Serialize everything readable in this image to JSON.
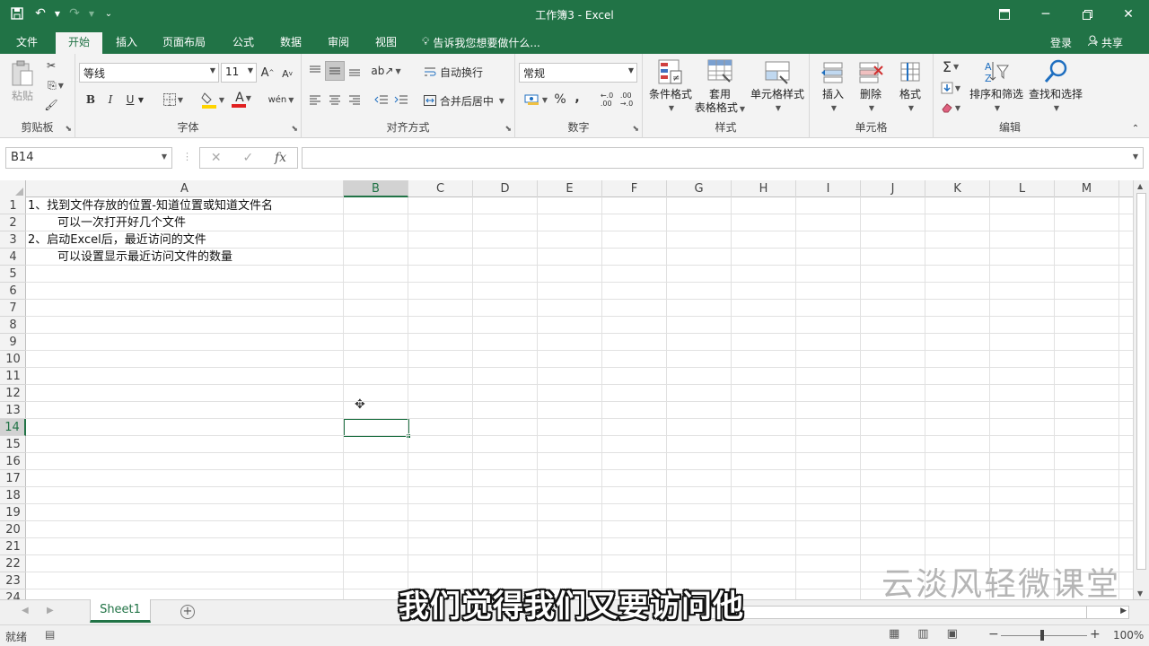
{
  "window": {
    "title": "工作簿3 - Excel",
    "qat": [
      {
        "name": "save-icon",
        "glyph": "🖫"
      },
      {
        "name": "undo-icon",
        "glyph": "↶"
      },
      {
        "name": "redo-icon",
        "glyph": "↷"
      },
      {
        "name": "customize-icon",
        "glyph": "⌄"
      }
    ],
    "window_buttons": [
      {
        "name": "ribbon-display-options-icon",
        "glyph": "⧉"
      },
      {
        "name": "minimize-icon",
        "glyph": "─"
      },
      {
        "name": "restore-icon",
        "glyph": "❐"
      },
      {
        "name": "close-icon",
        "glyph": "✕"
      }
    ]
  },
  "tabs": [
    {
      "label": "文件",
      "active": false
    },
    {
      "label": "开始",
      "active": true
    },
    {
      "label": "插入",
      "active": false
    },
    {
      "label": "页面布局",
      "active": false
    },
    {
      "label": "公式",
      "active": false
    },
    {
      "label": "数据",
      "active": false
    },
    {
      "label": "审阅",
      "active": false
    },
    {
      "label": "视图",
      "active": false
    }
  ],
  "tell_me": "告诉我您想要做什么...",
  "login": "登录",
  "share": "共享",
  "ribbon": {
    "clipboard": {
      "label": "剪贴板",
      "paste": "粘贴"
    },
    "font": {
      "label": "字体",
      "font_name": "等线",
      "font_size": "11",
      "bold": "B",
      "italic": "I",
      "underline": "U",
      "increase": "A",
      "decrease": "A",
      "font_color_letter": "A",
      "phonetic": "wén"
    },
    "alignment": {
      "label": "对齐方式",
      "wrap": "自动换行",
      "merge": "合并后居中"
    },
    "number": {
      "label": "数字",
      "format": "常规",
      "percent": "%",
      "comma": ","
    },
    "styles": {
      "label": "样式",
      "conditional": "条件格式",
      "table_line1": "套用",
      "table_line2": "表格格式",
      "cell_styles": "单元格样式"
    },
    "cells": {
      "label": "单元格",
      "insert": "插入",
      "delete": "删除",
      "format": "格式"
    },
    "editing": {
      "label": "编辑",
      "sort_filter": "排序和筛选",
      "find_select": "查找和选择"
    }
  },
  "formula_bar": {
    "name_box": "B14",
    "formula": ""
  },
  "columns": [
    "A",
    "B",
    "C",
    "D",
    "E",
    "F",
    "G",
    "H",
    "I",
    "J",
    "K",
    "L",
    "M"
  ],
  "selected_column": "B",
  "rows": [
    "1",
    "2",
    "3",
    "4",
    "5",
    "6",
    "7",
    "8",
    "9",
    "10",
    "11",
    "12",
    "13",
    "14",
    "15",
    "16",
    "17",
    "18",
    "19",
    "20",
    "21",
    "22",
    "23",
    "24"
  ],
  "selected_row": "14",
  "cells": {
    "A1": "1、找到文件存放的位置-知道位置或知道文件名",
    "A2": "可以一次打开好几个文件",
    "A3": "2、启动Excel后，最近访问的文件",
    "A4": "可以设置显示最近访问文件的数量"
  },
  "sheet_tab": "Sheet1",
  "status": {
    "mode": "就绪",
    "zoom": "100%",
    "zoom_level": 1.0
  },
  "overlay": {
    "watermark": "云淡风轻微课堂",
    "subtitle": "我们觉得我们又要访问他"
  },
  "colors": {
    "accent": "#217346"
  }
}
